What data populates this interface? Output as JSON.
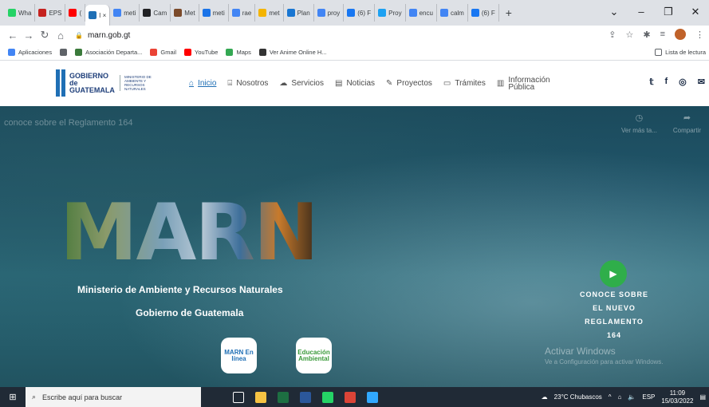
{
  "browser": {
    "tabs": [
      {
        "label": "Wha",
        "color": "#25d366"
      },
      {
        "label": "EPS",
        "color": "#c5221f"
      },
      {
        "label": "(",
        "color": "#ff0000"
      },
      {
        "label": "I ×",
        "color": "#1f6fb5",
        "active": true
      },
      {
        "label": "meti",
        "color": "#4285f4"
      },
      {
        "label": "Cam",
        "color": "#202124"
      },
      {
        "label": "Met",
        "color": "#7b4a2a"
      },
      {
        "label": "meti",
        "color": "#1a73e8"
      },
      {
        "label": "rae",
        "color": "#4285f4"
      },
      {
        "label": "met",
        "color": "#f4b400"
      },
      {
        "label": "Plan",
        "color": "#1976d2"
      },
      {
        "label": "proy",
        "color": "#4285f4"
      },
      {
        "label": "(6) F",
        "color": "#1877f2"
      },
      {
        "label": "Proy",
        "color": "#1da1f2"
      },
      {
        "label": "encu",
        "color": "#4285f4"
      },
      {
        "label": "calm",
        "color": "#4285f4"
      },
      {
        "label": "(6) F",
        "color": "#1877f2"
      }
    ],
    "new_tab": "+",
    "window_controls": {
      "chevron": "⌄",
      "minimize": "–",
      "maximize": "❐",
      "close": "✕"
    },
    "url": "marn.gob.gt",
    "bookmarks": [
      {
        "label": "Aplicaciones",
        "color": "#4285f4"
      },
      {
        "label": "",
        "color": "#5f6368"
      },
      {
        "label": "Asociación Departa...",
        "color": "#3b7a3b"
      },
      {
        "label": "Gmail",
        "color": "#ea4335"
      },
      {
        "label": "YouTube",
        "color": "#ff0000"
      },
      {
        "label": "Maps",
        "color": "#34a853"
      },
      {
        "label": "Ver Anime Online H...",
        "color": "#333333"
      }
    ],
    "reading_list": "Lista de lectura"
  },
  "site": {
    "logo_main": "GOBIERNO de GUATEMALA",
    "logo_sub": "MINISTERIO DE AMBIENTE Y RECURSOS NATURALES",
    "nav": [
      {
        "label": "Inicio",
        "icon": "⌂",
        "active": true
      },
      {
        "label": "Nosotros",
        "icon": "⌸"
      },
      {
        "label": "Servicios",
        "icon": "☁"
      },
      {
        "label": "Noticias",
        "icon": "▤"
      },
      {
        "label": "Proyectos",
        "icon": "✎"
      },
      {
        "label": "Trámites",
        "icon": "▭"
      }
    ],
    "info_publica_1": "Información",
    "info_publica_2": "Pública",
    "social": {
      "twitter": "𝕥",
      "facebook": "f",
      "instagram": "◎",
      "mail": "✉"
    }
  },
  "hero": {
    "video_title": "conoce sobre el Reglamento 164",
    "watch_later": "Ver más ta...",
    "share": "Compartir",
    "brand": "MARN",
    "ministry": "Ministerio de Ambiente y Recursos Naturales",
    "government": "Gobierno de Guatemala",
    "badge1": "MARN En línea",
    "badge2": "Educación Ambiental",
    "cta_lines": [
      "CONOCE SOBRE",
      "EL NUEVO",
      "REGLAMENTO",
      "164"
    ],
    "activate_title": "Activar Windows",
    "activate_sub": "Ve a Configuración para activar Windows."
  },
  "taskbar": {
    "search_placeholder": "Escribe aquí para buscar",
    "weather": "23°C Chubascos",
    "lang": "ESP",
    "time": "11:09",
    "date": "15/03/2022",
    "apps": [
      {
        "name": "task-view",
        "color": "#ffffff"
      },
      {
        "name": "file-explorer",
        "color": "#f6c343"
      },
      {
        "name": "excel",
        "color": "#1d6f42"
      },
      {
        "name": "word",
        "color": "#2b579a"
      },
      {
        "name": "whatsapp",
        "color": "#25d366"
      },
      {
        "name": "chrome",
        "color": "#db4437"
      },
      {
        "name": "photoshop",
        "color": "#31a8ff"
      }
    ]
  }
}
